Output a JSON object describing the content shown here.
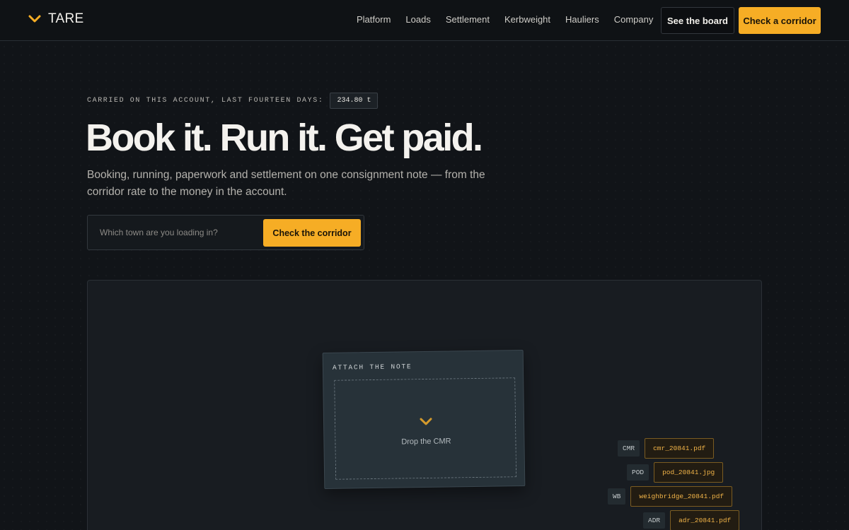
{
  "brand": {
    "name": "TARE",
    "icon": "chevron-down-icon",
    "accent": "#f6ad25"
  },
  "nav": {
    "links": [
      "Platform",
      "Loads",
      "Settlement",
      "Kerbweight",
      "Hauliers",
      "Company"
    ],
    "secondary_cta": "See the board",
    "primary_cta": "Check a corridor"
  },
  "hero": {
    "eyebrow_label": "CARRIED ON THIS ACCOUNT, LAST FOURTEEN DAYS:",
    "eyebrow_value": "234.80 t",
    "title": "Book it. Run it. Get paid.",
    "subtitle": "Booking, running, paperwork and settlement on one consignment note — from the corridor rate to the money in the account."
  },
  "search": {
    "placeholder": "Which town are you loading in?",
    "value": "",
    "button": "Check the corridor"
  },
  "upload": {
    "label": "ATTACH THE NOTE",
    "drop_text": "Drop the CMR",
    "icon": "chevron-down-icon",
    "files": [
      {
        "tag": "CMR",
        "name": "cmr_20841.pdf"
      },
      {
        "tag": "POD",
        "name": "pod_20841.jpg"
      },
      {
        "tag": "WB",
        "name": "weighbridge_20841.pdf"
      },
      {
        "tag": "ADR",
        "name": "adr_20841.pdf"
      }
    ]
  }
}
